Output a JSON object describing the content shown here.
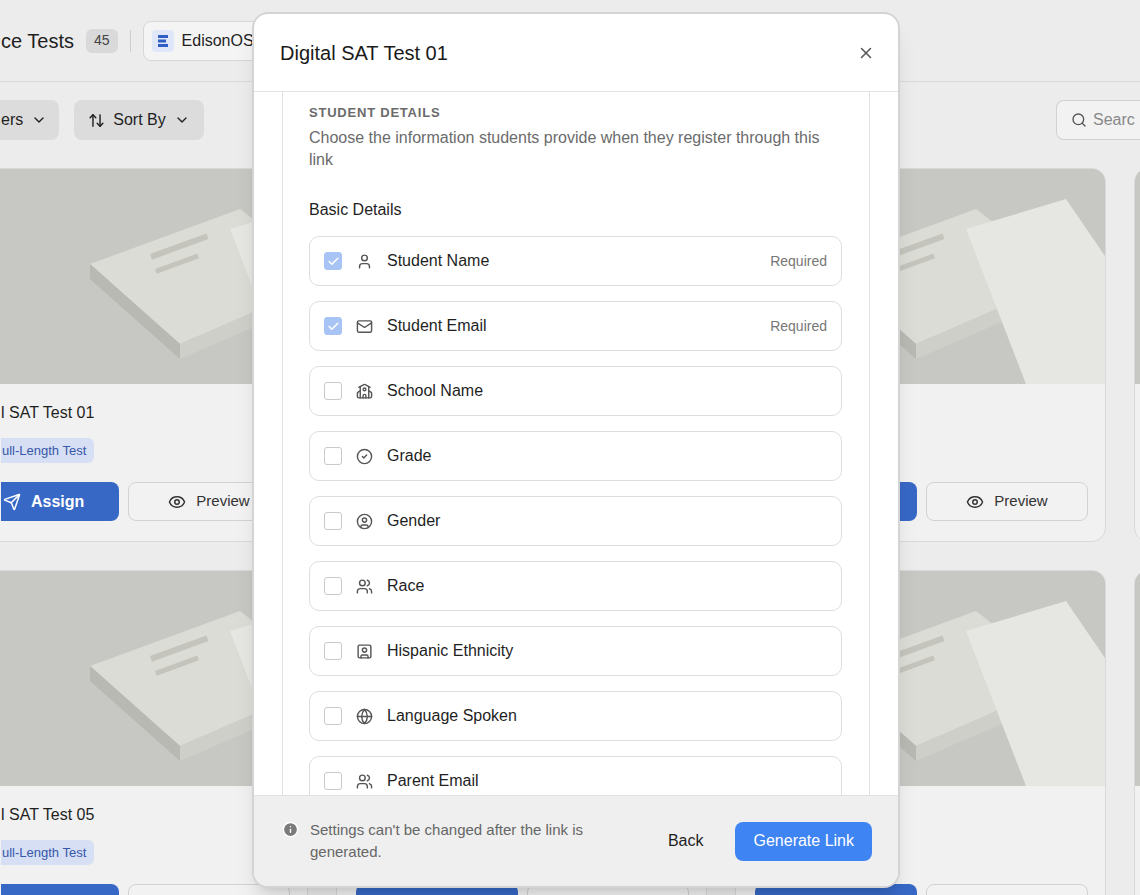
{
  "page": {
    "title": "ce Tests",
    "count": "45",
    "org": "EdisonOS"
  },
  "toolbar": {
    "filter": "ers",
    "sort": "Sort By",
    "search_placeholder": "Searc"
  },
  "card_rows": [
    {
      "left": {
        "title": "l SAT Test 01",
        "tag": "ull-Length Test",
        "assign": "Assign",
        "preview": "Preview"
      },
      "right": {
        "preview": "Preview"
      }
    },
    {
      "left": {
        "title": "l SAT Test 05",
        "tag": "ull-Length Test"
      },
      "right": {}
    }
  ],
  "dialog": {
    "title": "Digital SAT Test 01",
    "section": "STUDENT DETAILS",
    "description": "Choose the information students provide when they register through this link",
    "group": "Basic Details",
    "fields": [
      {
        "label": "Student Name",
        "checked": true,
        "disabled": true,
        "badge": "Required"
      },
      {
        "label": "Student Email",
        "checked": true,
        "disabled": true,
        "badge": "Required"
      },
      {
        "label": "School Name",
        "checked": false,
        "disabled": false
      },
      {
        "label": "Grade",
        "checked": false,
        "disabled": false
      },
      {
        "label": "Gender",
        "checked": false,
        "disabled": false
      },
      {
        "label": "Race",
        "checked": false,
        "disabled": false
      },
      {
        "label": "Hispanic Ethnicity",
        "checked": false,
        "disabled": false
      },
      {
        "label": "Language Spoken",
        "checked": false,
        "disabled": false
      },
      {
        "label": "Parent Email",
        "checked": false,
        "disabled": false
      }
    ],
    "note": "Settings can't be changed after the link is generated.",
    "back": "Back",
    "generate": "Generate Link"
  }
}
